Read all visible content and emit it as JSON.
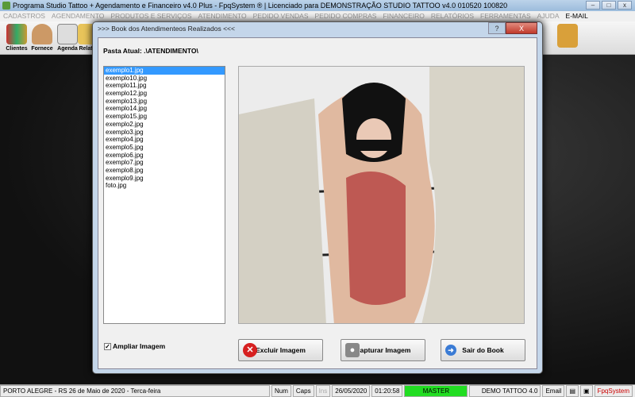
{
  "window": {
    "title": "Programa Studio Tattoo + Agendamento e Financeiro v4.0 Plus - FpqSystem ® | Licenciado para  DEMONSTRAÇÃO STUDIO TATTOO v4.0 010520 100820"
  },
  "menu": [
    "CADASTROS",
    "AGENDAMENTO",
    "PRODUTOS E SERVIÇOS",
    "ATENDIMENTO",
    "PEDIDO VENDAS",
    "PEDIDO COMPRAS",
    "FINANCEIRO",
    "RELATÓRIOS",
    "FERRAMENTAS",
    "AJUDA",
    "E-MAIL"
  ],
  "toolbar": {
    "clientes": "Clientes",
    "fornece": "Fornece",
    "agenda": "Agenda",
    "relat": "Relat"
  },
  "dialog": {
    "title": ">>>  Book dos Atendimenteos Realizados  <<<",
    "help": "?",
    "close": "X",
    "pasta": "Pasta Atual: .\\ATENDIMENTO\\",
    "files": [
      "exemplo1.jpg",
      "exemplo10.jpg",
      "exemplo11.jpg",
      "exemplo12.jpg",
      "exemplo13.jpg",
      "exemplo14.jpg",
      "exemplo15.jpg",
      "exemplo2.jpg",
      "exemplo3.jpg",
      "exemplo4.jpg",
      "exemplo5.jpg",
      "exemplo6.jpg",
      "exemplo7.jpg",
      "exemplo8.jpg",
      "exemplo9.jpg",
      "foto.jpg"
    ],
    "selected_file": "exemplo1.jpg",
    "ampliar": "Ampliar Imagem",
    "ampliar_checked": true,
    "buttons": {
      "excluir": "Excluir Imagem",
      "capturar": "Capturar Imagem",
      "sair": "Sair do Book"
    }
  },
  "status": {
    "location": "PORTO ALEGRE - RS 26 de Maio de 2020 - Terca-feira",
    "num": "Num",
    "caps": "Caps",
    "ins": "Ins",
    "date": "26/05/2020",
    "time": "01:20:58",
    "user": "MASTER",
    "demo": "DEMO TATTOO 4.0",
    "email": "Email",
    "brand": "FpqSystem"
  },
  "colors": {
    "master": "#22dd22",
    "selection": "#3399ff",
    "close": "#c0392b"
  }
}
